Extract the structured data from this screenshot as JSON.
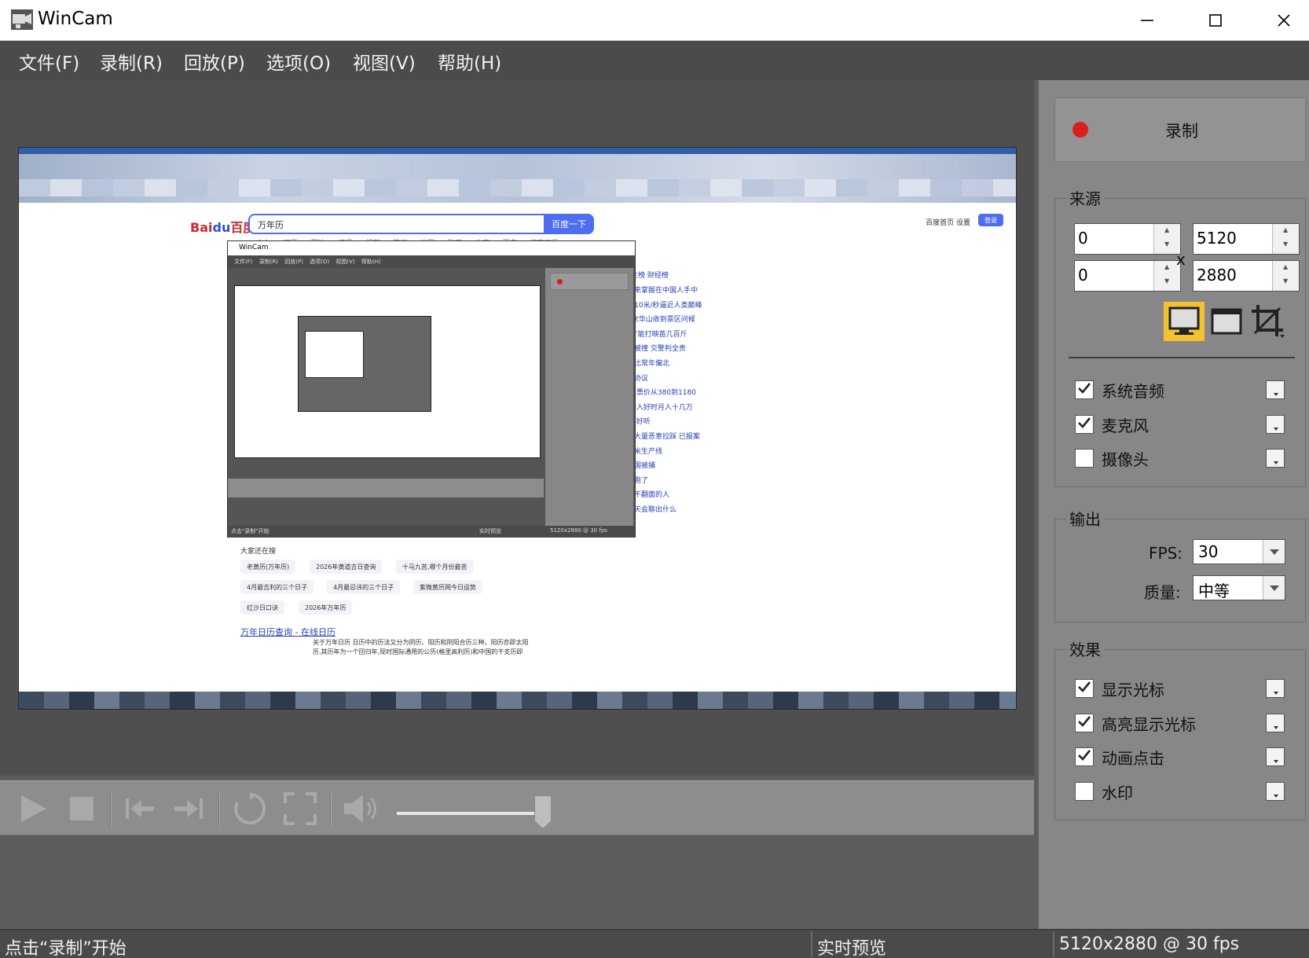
{
  "window": {
    "title": "WinCam"
  },
  "menu": [
    "文件(F)",
    "录制(R)",
    "回放(P)",
    "选项(O)",
    "视图(V)",
    "帮助(H)"
  ],
  "preview": {
    "baidu": {
      "logo_text": "Bai",
      "logo_du": "du",
      "logo_cn": "百度",
      "search_query": "万年历",
      "search_button": "百度一下",
      "top_links": "百度首页  设置",
      "login": "登录",
      "tabs": "文心 网页 图片 资讯 视频 笔记 地图 贴吧 文库 更多 搜索工具"
    },
    "nested_window": {
      "title": "WinCam",
      "menu": "文件(F) 录制(R) 回放(P) 选项(O) 视图(V) 帮助(H)",
      "status_left": "点击\"录制\"开始",
      "status_mid": "实时预览",
      "status_right": "5120x2880 @ 30 fps"
    },
    "hot_tabs": "民生榜    财经榜",
    "hot_list": [
      "罗未来掌握在中国人手中",
      "跑出10米/秒逼近人类巅峰",
      "第2次华山收到景区问候",
      "力士”能打映苗几百斤",
      "马路被撞 交警判全责",
      "位置比常年偏北",
      "达成协议",
      "合会 票价从380到1180",
      "瓜 收入好时月入十几万",
      "粗 不好听",
      "遭遇大量恶意拉踩 已报案",
      "造大米生产线",
      "在美国被捕",
      "交通跑了",
      "孩子不翻面的人",
      "国际天会聊出什么"
    ],
    "also_search_title": "大家还在搜",
    "also_search": [
      "老黄历(万年历)",
      "2026年黄道吉日查询",
      "十马九苦,哪个月份最苦",
      "4月最吉利的三个日子",
      "4月最忌讳的三个日子",
      "紫微黄历网今日运势",
      "红沙日口诀",
      "2026年万年历"
    ],
    "result_title": "万年日历查询 - 在线日历",
    "result_desc": "关于万年日历 日历中的历法又分为阴历、阳历和阴阳合历三种。阳历亦即太阳历,其历年为一个回归年,现时国际通用的公历(格里高利历)和中国的干支历即"
  },
  "controls": {
    "play": "play-icon",
    "stop": "stop-icon",
    "prev": "skip-start-icon",
    "next": "skip-end-icon",
    "loop": "loop-icon",
    "fullscreen": "fullscreen-icon",
    "volume": "volume-icon",
    "volume_level": 0.92
  },
  "record": {
    "label": "录制"
  },
  "source": {
    "title": "来源",
    "x": "0",
    "y": "0",
    "width": "5120",
    "height": "2880",
    "times": "x",
    "modes": [
      "monitor-icon",
      "window-icon",
      "crop-icon"
    ],
    "active_mode": "monitor-icon",
    "options": [
      {
        "label": "系统音频",
        "checked": true
      },
      {
        "label": "麦克风",
        "checked": true
      },
      {
        "label": "摄像头",
        "checked": false
      }
    ]
  },
  "output": {
    "title": "输出",
    "fps_label": "FPS:",
    "fps_value": "30",
    "quality_label": "质量:",
    "quality_value": "中等"
  },
  "effects": {
    "title": "效果",
    "options": [
      {
        "label": "显示光标",
        "checked": true
      },
      {
        "label": "高亮显示光标",
        "checked": true
      },
      {
        "label": "动画点击",
        "checked": true
      },
      {
        "label": "水印",
        "checked": false
      }
    ]
  },
  "status": {
    "left": "点击“录制”开始",
    "mid": "实时预览",
    "right": "5120x2880 @ 30 fps"
  },
  "colors": {
    "record_red": "#d91e1e",
    "active_mode_bg": "#f4c230",
    "baidu_blue": "#4e6ef2"
  }
}
